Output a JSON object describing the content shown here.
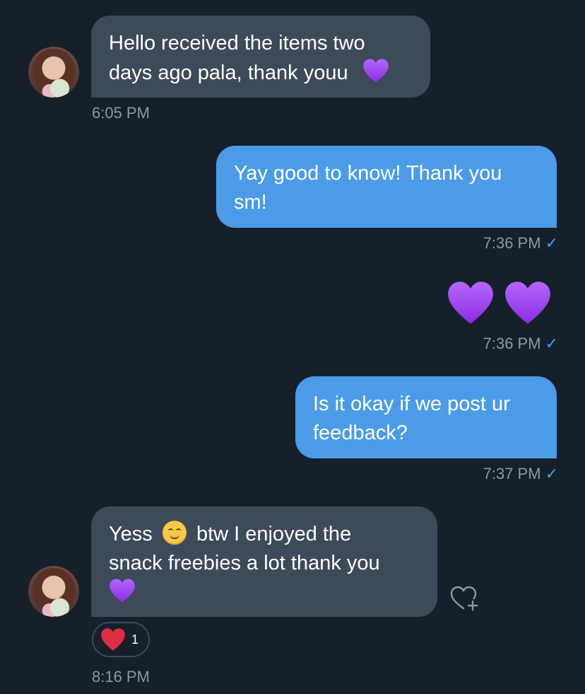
{
  "messages": [
    {
      "direction": "incoming",
      "line1": "Hello received the items two",
      "line2": "days ago pala, thank youu",
      "emoji": "purple-heart",
      "time": "6:05 PM"
    },
    {
      "direction": "outgoing",
      "line1": "Yay good to know! Thank you",
      "line2": "sm!",
      "time": "7:36 PM",
      "read_mark": "✓"
    },
    {
      "direction": "outgoing",
      "emoji_only": [
        "purple-heart",
        "purple-heart"
      ],
      "time": "7:36 PM",
      "read_mark": "✓"
    },
    {
      "direction": "outgoing",
      "line1": "Is it okay if we post ur",
      "line2": "feedback?",
      "time": "7:37 PM",
      "read_mark": "✓"
    },
    {
      "direction": "incoming",
      "line1_pre": "Yess",
      "line1_emoji": "smiling-face",
      "line1_post": "btw I enjoyed the",
      "line2": "snack freebies a lot thank you",
      "line3_emoji": "purple-heart",
      "time": "8:16 PM",
      "reaction": {
        "emoji": "red-heart",
        "count": "1"
      },
      "add_reaction_icon": "heart-plus-icon"
    }
  ],
  "colors": {
    "background": "#15202b",
    "incoming_bubble": "#3d4a59",
    "outgoing_bubble": "#4b9be9",
    "timestamp": "#8899a6",
    "purple_heart": "#9b3ff0",
    "red_heart": "#e0245e"
  }
}
